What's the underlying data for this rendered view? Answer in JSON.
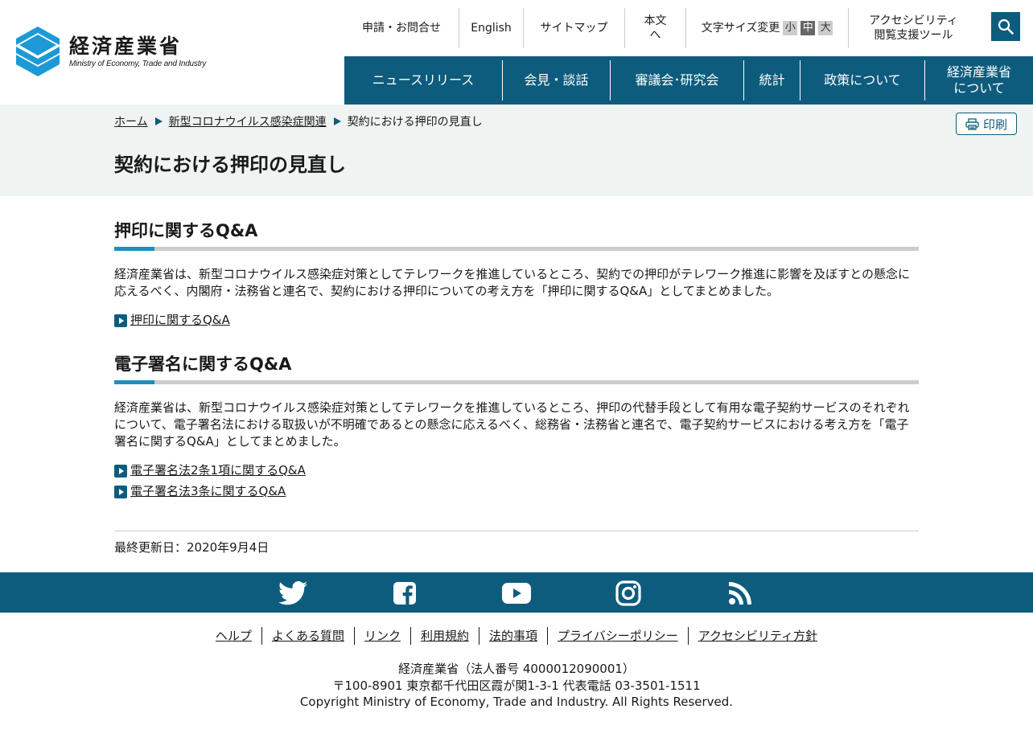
{
  "header": {
    "logo_jp": "経済産業省",
    "logo_en": "Ministry of Economy, Trade and Industry",
    "util_nav": {
      "contact": "申請・お問合せ",
      "english": "English",
      "sitemap": "サイトマップ",
      "skip_to_content": "本文へ",
      "font_size_label": "文字サイズ変更",
      "font_small": "小",
      "font_medium": "中",
      "font_large": "大",
      "accessibility_line1": "アクセシビリティ",
      "accessibility_line2": "閲覧支援ツール"
    },
    "main_nav": [
      {
        "line1": "ニュースリリース",
        "line2": ""
      },
      {
        "line1": "会見・談話",
        "line2": ""
      },
      {
        "line1": "審議会･研究会",
        "line2": ""
      },
      {
        "line1": "統計",
        "line2": ""
      },
      {
        "line1": "政策について",
        "line2": ""
      },
      {
        "line1": "経済産業省",
        "line2": "について"
      }
    ],
    "colors": {
      "brand": "#0e5c7d",
      "accent": "#1c8ec2",
      "logo_blue": "#1b9ad6"
    }
  },
  "breadcrumb": {
    "home": "ホーム",
    "category": "新型コロナウイルス感染症関連",
    "current": "契約における押印の見直し"
  },
  "print_label": "印刷",
  "page_title": "契約における押印の見直し",
  "sections": [
    {
      "heading": "押印に関するQ&A",
      "body": "経済産業省は、新型コロナウイルス感染症対策としてテレワークを推進しているところ、契約での押印がテレワーク推進に影響を及ぼすとの懸念に応えるべく、内閣府・法務省と連名で、契約における押印についての考え方を「押印に関するQ&A」としてまとめました。",
      "links": [
        "押印に関するQ&A"
      ]
    },
    {
      "heading": "電子署名に関するQ&A",
      "body": "経済産業省は、新型コロナウイルス感染症対策としてテレワークを推進しているところ、押印の代替手段として有用な電子契約サービスのそれぞれについて、電子署名法における取扱いが不明確であるとの懸念に応えるべく、総務省・法務省と連名で、電子契約サービスにおける考え方を「電子署名に関するQ&A」としてまとめました。",
      "links": [
        "電子署名法2条1項に関するQ&A",
        "電子署名法3条に関するQ&A"
      ]
    }
  ],
  "last_updated": "最終更新日：2020年9月4日",
  "footer": {
    "social": [
      "twitter-icon",
      "facebook-icon",
      "youtube-icon",
      "instagram-icon",
      "rss-icon"
    ],
    "links": [
      "ヘルプ",
      "よくある質問",
      "リンク",
      "利用規約",
      "法的事項",
      "プライバシーポリシー",
      "アクセシビリティ方針"
    ],
    "info_line1": "経済産業省（法人番号 4000012090001）",
    "info_line2": "〒100-8901 東京都千代田区霞が関1-3-1 代表電話 03-3501-1511",
    "info_line3": "Copyright Ministry of Economy, Trade and Industry. All Rights Reserved."
  }
}
